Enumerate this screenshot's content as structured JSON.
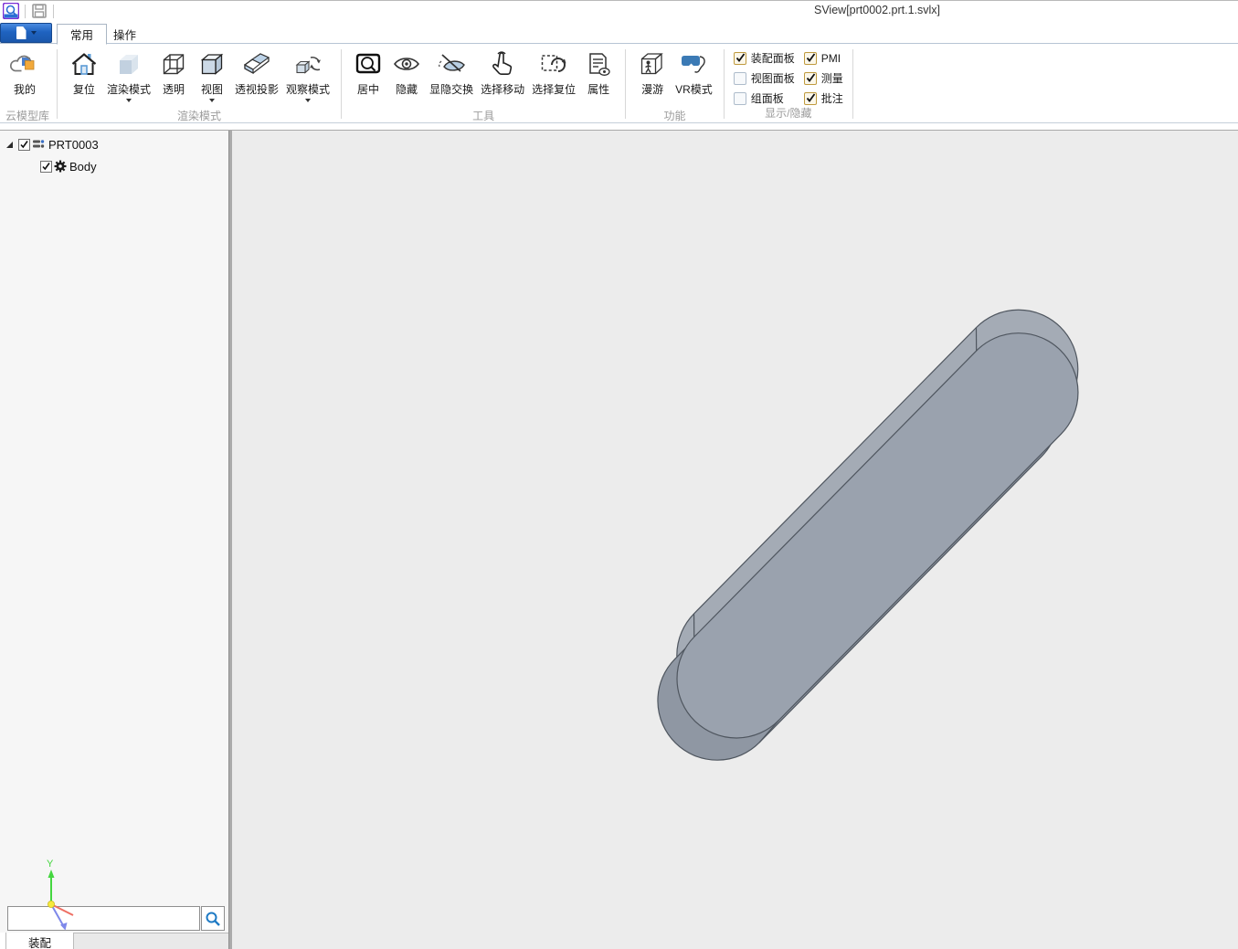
{
  "window": {
    "title": "SView[prt0002.prt.1.svlx]"
  },
  "tabs": {
    "home": "常用",
    "operate": "操作"
  },
  "ribbon": {
    "groups": {
      "cloud": {
        "label": "云模型库",
        "my": "我的"
      },
      "render": {
        "label": "渲染模式",
        "reset": "复位",
        "render_mode": "渲染模式",
        "transparent": "透明",
        "view": "视图",
        "perspective": "透视投影",
        "observe": "观察模式"
      },
      "tools": {
        "label": "工具",
        "center": "居中",
        "hide": "隐藏",
        "toggle_visibility": "显隐交换",
        "select_move": "选择移动",
        "select_reset": "选择复位",
        "properties": "属性"
      },
      "features": {
        "label": "功能",
        "roam": "漫游",
        "vr": "VR模式"
      },
      "display": {
        "label": "显示/隐藏",
        "assembly_panel": {
          "label": "装配面板",
          "checked": true
        },
        "view_panel": {
          "label": "视图面板",
          "checked": false
        },
        "group_panel": {
          "label": "组面板",
          "checked": false
        },
        "pmi": {
          "label": "PMI",
          "checked": true
        },
        "measure": {
          "label": "测量",
          "checked": true
        },
        "annotation": {
          "label": "批注",
          "checked": true
        }
      }
    }
  },
  "tree": {
    "root": "PRT0003",
    "body": "Body"
  },
  "viewport": {
    "axis_y": "Y"
  },
  "bottom": {
    "assembly_tab": "装配",
    "search_value": ""
  },
  "colors": {
    "accent_blue": "#1f63c0",
    "checkbox_gold": "#bf9a3e",
    "viewport_bg": "#ececec",
    "model_gray": "#9aa2ae"
  }
}
